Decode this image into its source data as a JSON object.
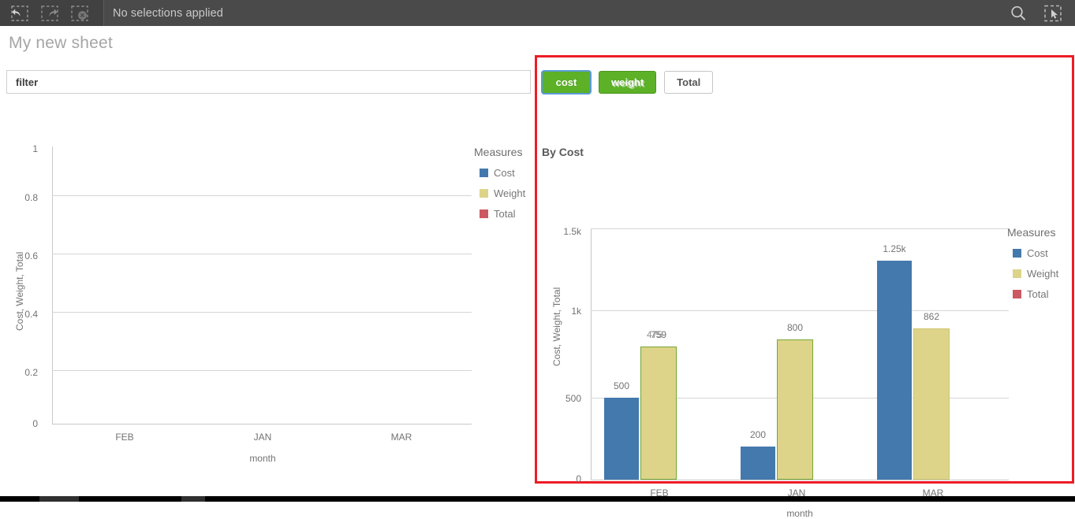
{
  "topbar": {
    "undo_label": "Undo selection",
    "redo_label": "Redo selection",
    "clear_label": "Clear all selections",
    "selection_status": "No selections applied",
    "search_label": "Smart search",
    "selection_tool_label": "Selections tool"
  },
  "sheet": {
    "title": "My new sheet"
  },
  "filter": {
    "value": "filter",
    "placeholder": "filter"
  },
  "buttons": [
    {
      "label": "cost",
      "style": "green",
      "focused": true,
      "ghost": false
    },
    {
      "label": "weight",
      "style": "green",
      "focused": false,
      "ghost": true
    },
    {
      "label": "Total",
      "style": "white",
      "focused": false,
      "ghost": false
    }
  ],
  "left_chart": {
    "legend_title": "Measures",
    "legend": [
      {
        "label": "Cost",
        "color": "#4479ad"
      },
      {
        "label": "Weight",
        "color": "#ddd48a"
      },
      {
        "label": "Total",
        "color": "#cb5a62"
      }
    ]
  },
  "right_panel": {
    "chart_title": "By Cost",
    "legend_title": "Measures",
    "legend": [
      {
        "label": "Cost",
        "color": "#4479ad"
      },
      {
        "label": "Weight",
        "color": "#ddd48a"
      },
      {
        "label": "Total",
        "color": "#cb5a62"
      }
    ]
  },
  "chart_data": [
    {
      "id": "left",
      "type": "bar",
      "title": "",
      "xlabel": "month",
      "ylabel": "Cost, Weight, Total",
      "categories": [
        "FEB",
        "JAN",
        "MAR"
      ],
      "yticks": [
        "0",
        "0.2",
        "0.4",
        "0.6",
        "0.8",
        "1"
      ],
      "ylim": [
        0,
        1
      ],
      "grid": true,
      "legend_position": "right",
      "series": [
        {
          "name": "Cost",
          "color": "#4479ad",
          "values": [
            null,
            null,
            null
          ]
        },
        {
          "name": "Weight",
          "color": "#ddd48a",
          "values": [
            null,
            null,
            null
          ]
        },
        {
          "name": "Total",
          "color": "#cb5a62",
          "values": [
            null,
            null,
            null
          ]
        }
      ]
    },
    {
      "id": "right",
      "type": "bar",
      "title": "By Cost",
      "xlabel": "month",
      "ylabel": "Cost, Weight, Total",
      "categories": [
        "FEB",
        "JAN",
        "MAR"
      ],
      "yticks": [
        "0",
        "500",
        "1k",
        "1.5k"
      ],
      "ylim": [
        0,
        1500
      ],
      "grid": true,
      "legend_position": "right",
      "series": [
        {
          "name": "Cost",
          "color": "#4479ad",
          "values": [
            500,
            200,
            1250
          ],
          "labels": [
            "500",
            "200",
            "1.25k"
          ]
        },
        {
          "name": "Weight",
          "color": "#ddd48a",
          "values": [
            759,
            800,
            862
          ],
          "labels": [
            "759",
            "800",
            "862"
          ],
          "label_ghosts": [
            "475",
            "",
            ""
          ]
        }
      ]
    }
  ]
}
